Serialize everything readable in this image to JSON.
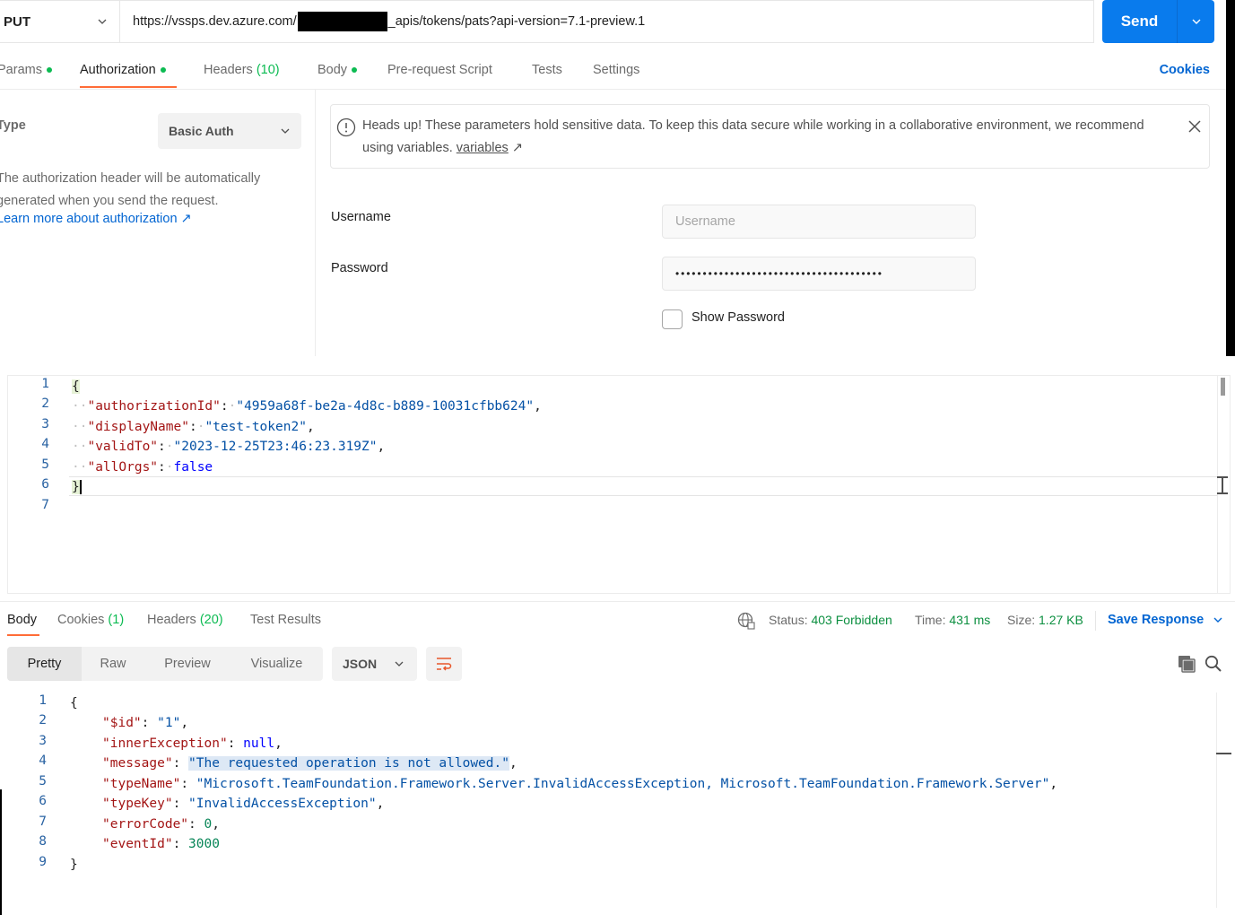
{
  "request": {
    "method": "PUT",
    "url_prefix": "https://vssps.dev.azure.com/",
    "url_suffix": "_apis/tokens/pats?api-version=7.1-preview.1",
    "send_label": "Send"
  },
  "req_tabs": {
    "params": "Params",
    "authorization": "Authorization",
    "headers": "Headers",
    "headers_count": "(10)",
    "body": "Body",
    "pre_request": "Pre-request Script",
    "tests": "Tests",
    "settings": "Settings",
    "cookies": "Cookies"
  },
  "auth": {
    "type_label": "Type",
    "type_value": "Basic Auth",
    "description": "The authorization header will be automatically generated when you send the request.",
    "learn_more": "Learn more about authorization ↗",
    "warning_text": "Heads up! These parameters hold sensitive data. To keep this data secure while working in a collaborative environment, we recommend using variables.",
    "warning_link": "variables",
    "username_label": "Username",
    "username_placeholder": "Username",
    "password_label": "Password",
    "password_value": "••••••••••••••••••••••••••••••••••••••",
    "show_password": "Show Password"
  },
  "request_body": {
    "lines": [
      "1",
      "2",
      "3",
      "4",
      "5",
      "6",
      "7"
    ],
    "k1": "\"authorizationId\"",
    "v1": "\"4959a68f-be2a-4d8c-b889-10031cfbb624\"",
    "k2": "\"displayName\"",
    "v2": "\"test-token2\"",
    "k3": "\"validTo\"",
    "v3": "\"2023-12-25T23:46:23.319Z\"",
    "k4": "\"allOrgs\"",
    "v4": "false",
    "open": "{",
    "close": "}"
  },
  "response_tabs": {
    "body": "Body",
    "cookies": "Cookies",
    "cookies_count": "(1)",
    "headers": "Headers",
    "headers_count": "(20)",
    "test_results": "Test Results"
  },
  "response_status": {
    "status_label": "Status:",
    "status_value": "403 Forbidden",
    "time_label": "Time:",
    "time_value": "431 ms",
    "size_label": "Size:",
    "size_value": "1.27 KB",
    "save_response": "Save Response"
  },
  "response_view": {
    "pretty": "Pretty",
    "raw": "Raw",
    "preview": "Preview",
    "visualize": "Visualize",
    "format": "JSON"
  },
  "response_body": {
    "lines": [
      "1",
      "2",
      "3",
      "4",
      "5",
      "6",
      "7",
      "8",
      "9"
    ],
    "open": "{",
    "close": "}",
    "k1": "\"$id\"",
    "v1": "\"1\"",
    "k2": "\"innerException\"",
    "v2": "null",
    "k3": "\"message\"",
    "v3": "\"The requested operation is not allowed.\"",
    "k4": "\"typeName\"",
    "v4": "\"Microsoft.TeamFoundation.Framework.Server.InvalidAccessException, Microsoft.TeamFoundation.Framework.Server\"",
    "k5": "\"typeKey\"",
    "v5": "\"InvalidAccessException\"",
    "k6": "\"errorCode\"",
    "v6": "0",
    "k7": "\"eventId\"",
    "v7": "3000"
  },
  "colors": {
    "accent": "#ff6c37",
    "primary": "#097bed",
    "success": "#0cbb52",
    "link": "#0265d2"
  }
}
